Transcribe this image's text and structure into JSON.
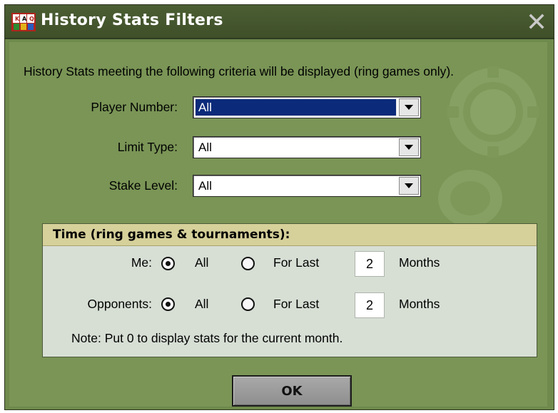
{
  "window": {
    "title": "History Stats Filters",
    "icons": {
      "app": "poker-app-icon",
      "close": "close-icon"
    }
  },
  "intro_text": "History Stats meeting the following criteria will be displayed (ring games only).",
  "filters": {
    "player_number": {
      "label": "Player Number:",
      "value": "All"
    },
    "limit_type": {
      "label": "Limit Type:",
      "value": "All"
    },
    "stake_level": {
      "label": "Stake Level:",
      "value": "All"
    }
  },
  "time_group": {
    "title": "Time (ring games & tournaments):",
    "me": {
      "label": "Me:",
      "all_label": "All",
      "for_last_label": "For Last",
      "months_value": "2",
      "months_label": "Months",
      "selected": "All"
    },
    "opponents": {
      "label": "Opponents:",
      "all_label": "All",
      "for_last_label": "For Last",
      "months_value": "2",
      "months_label": "Months",
      "selected": "All"
    },
    "note": "Note: Put 0 to display stats for the current month."
  },
  "ok_label": "OK",
  "colors": {
    "background": "#7a9556",
    "titlebar": "#445630",
    "selection": "#0b2a7a",
    "group_header": "#d6d09a",
    "group_body": "#d7dfd5"
  }
}
